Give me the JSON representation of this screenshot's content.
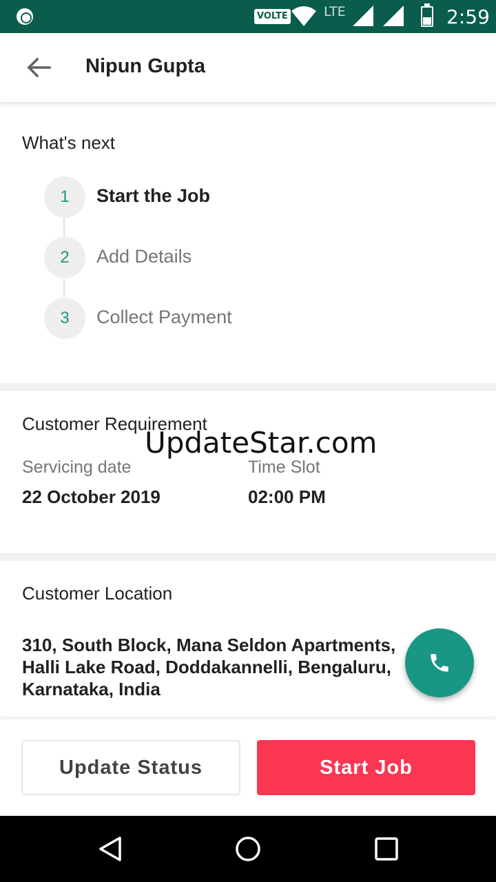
{
  "status_bar": {
    "network_badge": "VOLTE",
    "network_type": "LTE",
    "time": "2:59"
  },
  "app_bar": {
    "title": "Nipun Gupta"
  },
  "whats_next": {
    "heading": "What's next",
    "steps": [
      {
        "number": "1",
        "label": "Start the Job",
        "active": true
      },
      {
        "number": "2",
        "label": "Add Details",
        "active": false
      },
      {
        "number": "3",
        "label": "Collect Payment",
        "active": false
      }
    ]
  },
  "customer_requirement": {
    "heading": "Customer Requirement",
    "servicing_date_label": "Servicing date",
    "servicing_date_value": "22 October 2019",
    "time_slot_label": "Time Slot",
    "time_slot_value": "02:00 PM"
  },
  "watermark": "UpdateStar.com",
  "customer_location": {
    "heading": "Customer Location",
    "address_line1": "310, South Block, Mana Seldon Apartments,",
    "address_line2": "Halli Lake Road, Doddakannelli, Bengaluru,",
    "address_line3": "Karnataka, India"
  },
  "actions": {
    "update_status_label": "Update Status",
    "start_job_label": "Start Job"
  },
  "colors": {
    "status_bar": "#0a5c4c",
    "accent_teal": "#1a9684",
    "primary_red": "#fa3653"
  },
  "icons": {
    "back": "arrow-left-icon",
    "call": "phone-icon",
    "nav_back": "triangle-back-icon",
    "nav_home": "circle-home-icon",
    "nav_recents": "square-recents-icon"
  }
}
